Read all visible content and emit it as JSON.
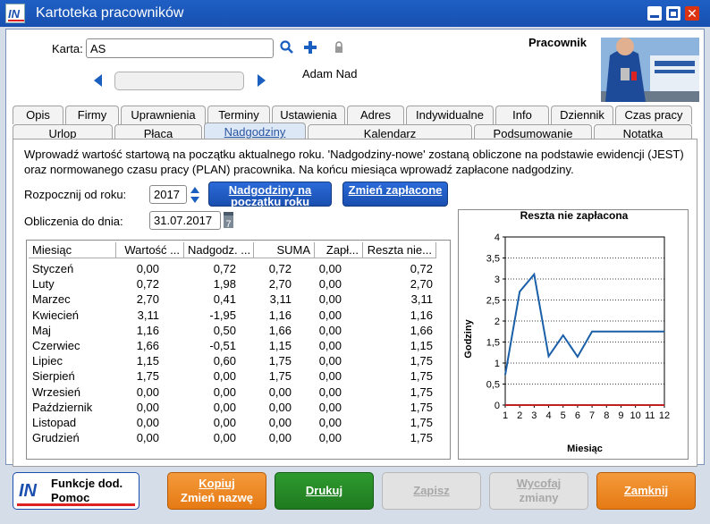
{
  "window": {
    "title": "Kartoteka pracowników",
    "close_glyph": "✕"
  },
  "header": {
    "karta_label": "Karta:",
    "karta_value": "AS",
    "employee_name": "Adam Nad",
    "pracownik_label": "Pracownik"
  },
  "tabs_row1": [
    "Opis",
    "Firmy",
    "Uprawnienia",
    "Terminy",
    "Ustawienia",
    "Adres",
    "Indywidualne",
    "Info",
    "Dziennik",
    "Czas pracy"
  ],
  "tabs_row2": [
    "Urlop",
    "Płaca",
    "Nadgodziny",
    "Kalendarz",
    "Podsumowanie",
    "Notatka"
  ],
  "active_tab": "Nadgodziny",
  "info_text": "Wprowadź wartość startową na początku aktualnego roku. 'Nadgodziny-nowe' zostaną obliczone na podstawie ewidencji (JEST) oraz normowanego czasu pracy (PLAN) pracownika. Na końcu miesiąca wprowadź zapłacone nadgodziny.",
  "form": {
    "start_year_label": "Rozpocznij od roku:",
    "start_year_value": "2017",
    "calc_date_label": "Obliczenia do dnia:",
    "calc_date_value": "31.07.2017",
    "calendar_glyph": "7",
    "btn_start_overtime": "Nadgodziny na początku roku",
    "btn_change_paid": "Zmień zapłacone"
  },
  "table": {
    "columns": [
      "Miesiąc",
      "Wartość ...",
      "Nadgodz. ...",
      "SUMA",
      "Zapł...",
      "Reszta nie..."
    ],
    "rows": [
      [
        "Styczeń",
        "0,00",
        "0,72",
        "0,72",
        "0,00",
        "0,72"
      ],
      [
        "Luty",
        "0,72",
        "1,98",
        "2,70",
        "0,00",
        "2,70"
      ],
      [
        "Marzec",
        "2,70",
        "0,41",
        "3,11",
        "0,00",
        "3,11"
      ],
      [
        "Kwiecień",
        "3,11",
        "-1,95",
        "1,16",
        "0,00",
        "1,16"
      ],
      [
        "Maj",
        "1,16",
        "0,50",
        "1,66",
        "0,00",
        "1,66"
      ],
      [
        "Czerwiec",
        "1,66",
        "-0,51",
        "1,15",
        "0,00",
        "1,15"
      ],
      [
        "Lipiec",
        "1,15",
        "0,60",
        "1,75",
        "0,00",
        "1,75"
      ],
      [
        "Sierpień",
        "1,75",
        "0,00",
        "1,75",
        "0,00",
        "1,75"
      ],
      [
        "Wrzesień",
        "0,00",
        "0,00",
        "0,00",
        "0,00",
        "1,75"
      ],
      [
        "Październik",
        "0,00",
        "0,00",
        "0,00",
        "0,00",
        "1,75"
      ],
      [
        "Listopad",
        "0,00",
        "0,00",
        "0,00",
        "0,00",
        "1,75"
      ],
      [
        "Grudzień",
        "0,00",
        "0,00",
        "0,00",
        "0,00",
        "1,75"
      ]
    ]
  },
  "chart_data": {
    "type": "line",
    "title": "Reszta nie zapłacona",
    "xlabel": "Miesiąc",
    "ylabel": "Godziny",
    "x": [
      1,
      2,
      3,
      4,
      5,
      6,
      7,
      8,
      9,
      10,
      11,
      12
    ],
    "ylim": [
      0,
      4
    ],
    "yticks": [
      "0",
      "0,5",
      "1",
      "1,5",
      "2",
      "2,5",
      "3",
      "3,5",
      "4"
    ],
    "series": [
      {
        "values": [
          0.72,
          2.7,
          3.11,
          1.16,
          1.66,
          1.15,
          1.75,
          1.75,
          1.75,
          1.75,
          1.75,
          1.75
        ],
        "color": "#1a5fa8"
      },
      {
        "values": [
          0,
          0,
          0,
          0,
          0,
          0,
          0,
          0,
          0,
          0,
          0,
          0
        ],
        "color": "#c02020"
      }
    ],
    "grid": true
  },
  "bottom": {
    "func_line1": "Funkcje dod.",
    "func_line2": "Pomoc",
    "copy_line1": "Kopiuj",
    "copy_line2": "Zmień nazwę",
    "print": "Drukuj",
    "save": "Zapisz",
    "withdraw_line1": "Wycofaj",
    "withdraw_line2": "zmiany",
    "close": "Zamknij"
  },
  "colors": {
    "title_bar": "#1750b0",
    "accent_blue": "#1a5fbf",
    "orange": "#e57a14",
    "green": "#1f7a1f"
  }
}
